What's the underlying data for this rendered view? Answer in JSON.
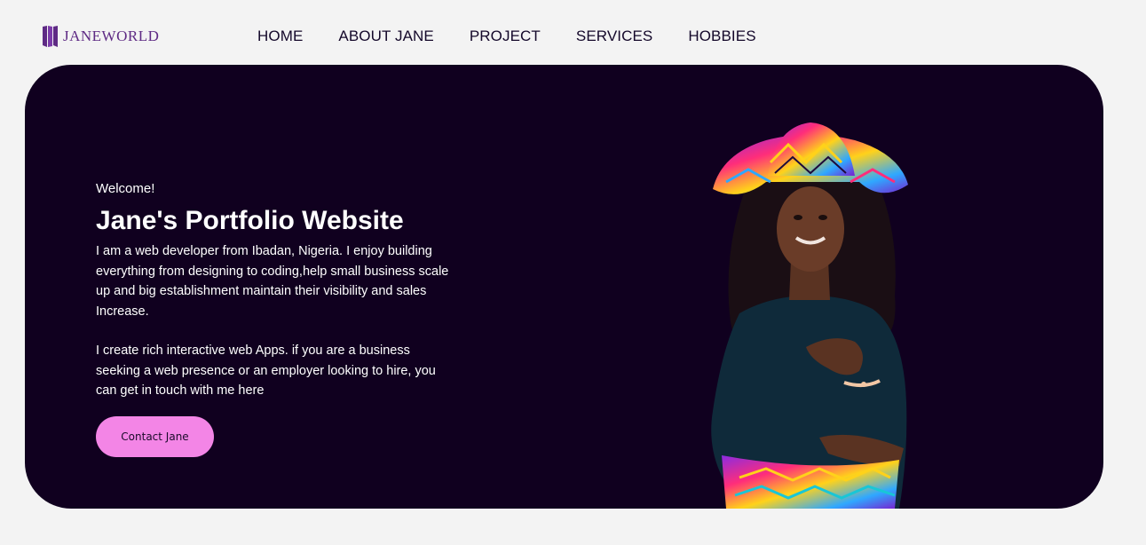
{
  "brand": {
    "name": "JANEWORLD",
    "logo_icon": "jw-monogram-icon",
    "color": "#5e2a84"
  },
  "nav": {
    "items": [
      {
        "label": "HOME"
      },
      {
        "label": "ABOUT JANE"
      },
      {
        "label": "PROJECT"
      },
      {
        "label": "SERVICES"
      },
      {
        "label": "HOBBIES"
      }
    ]
  },
  "hero": {
    "welcome": "Welcome!",
    "title": "Jane's Portfolio Website",
    "paragraph1": "I am a web developer from Ibadan, Nigeria. I enjoy building everything from designing to coding,help small business scale up and big establishment maintain their visibility and sales Increase.",
    "paragraph2": "I create rich interactive web Apps. if you are a business seeking a web presence or an employer looking to hire, you can get in touch with me here",
    "cta_label": "Contact Jane",
    "background": "#10001f",
    "cta_color": "#f385e6"
  },
  "colors": {
    "page_bg": "#f3f3f3",
    "nav_text": "#14082a"
  }
}
